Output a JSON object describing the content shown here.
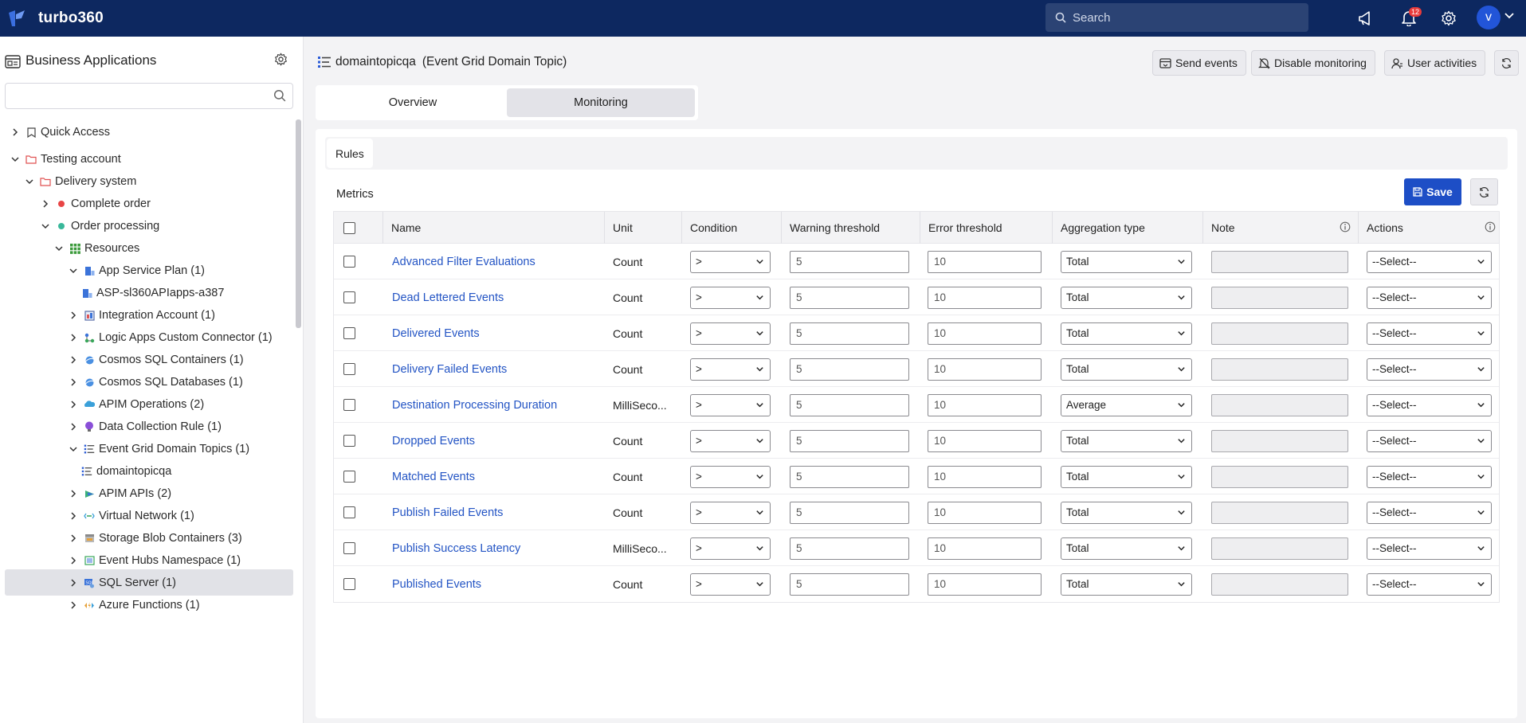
{
  "app": {
    "name": "turbo360",
    "search_placeholder": "Search",
    "notification_count": "12",
    "user_initial": "v"
  },
  "sidebar": {
    "title": "Business Applications",
    "tree": [
      {
        "label": "Quick Access",
        "expanded": false,
        "icon": "bookmark-icon"
      },
      {
        "label": "Testing account",
        "expanded": true,
        "icon": "folder-icon"
      },
      {
        "label": "Delivery system",
        "expanded": true,
        "icon": "folder-icon"
      },
      {
        "label": "Complete order",
        "expanded": false,
        "icon": "status-dot-red"
      },
      {
        "label": "Order processing",
        "expanded": true,
        "icon": "status-dot-green"
      },
      {
        "label": "Resources",
        "expanded": true,
        "icon": "grid-icon"
      },
      {
        "label": "App Service Plan (1)",
        "expanded": true,
        "icon": "app-service-icon"
      },
      {
        "label": "ASP-sl360APIapps-a387",
        "icon": "app-service-icon"
      },
      {
        "label": "Integration Account (1)",
        "expanded": false,
        "icon": "integration-icon"
      },
      {
        "label": "Logic Apps Custom Connector (1)",
        "expanded": false,
        "icon": "connector-icon"
      },
      {
        "label": "Cosmos SQL Containers (1)",
        "expanded": false,
        "icon": "cosmos-icon"
      },
      {
        "label": "Cosmos SQL Databases (1)",
        "expanded": false,
        "icon": "cosmos-icon"
      },
      {
        "label": "APIM Operations (2)",
        "expanded": false,
        "icon": "apim-icon"
      },
      {
        "label": "Data Collection Rule (1)",
        "expanded": false,
        "icon": "bulb-icon"
      },
      {
        "label": "Event Grid Domain Topics (1)",
        "expanded": true,
        "icon": "eventgrid-icon"
      },
      {
        "label": "domaintopicqa",
        "icon": "eventgrid-icon",
        "selected": true
      },
      {
        "label": "APIM APIs (2)",
        "expanded": false,
        "icon": "apim-api-icon"
      },
      {
        "label": "Virtual Network (1)",
        "expanded": false,
        "icon": "vnet-icon"
      },
      {
        "label": "Storage Blob Containers (3)",
        "expanded": false,
        "icon": "storage-icon"
      },
      {
        "label": "Event Hubs Namespace (1)",
        "expanded": false,
        "icon": "eventhub-icon"
      },
      {
        "label": "SQL Server (1)",
        "expanded": false,
        "icon": "sql-icon"
      },
      {
        "label": "Azure Functions (1)",
        "expanded": false,
        "icon": "function-icon"
      }
    ]
  },
  "header": {
    "resource_name": "domaintopicqa",
    "resource_type": "(Event Grid Domain Topic)",
    "buttons": {
      "send_events": "Send events",
      "disable_monitoring": "Disable monitoring",
      "user_activities": "User activities"
    }
  },
  "tabs": {
    "overview": "Overview",
    "monitoring": "Monitoring",
    "active": "monitoring"
  },
  "subtabs": {
    "rules": "Rules"
  },
  "metrics": {
    "label": "Metrics",
    "save_label": "Save",
    "columns": {
      "name": "Name",
      "unit": "Unit",
      "condition": "Condition",
      "warning": "Warning threshold",
      "error": "Error threshold",
      "aggregation": "Aggregation type",
      "note": "Note",
      "actions": "Actions"
    },
    "rows": [
      {
        "name": "Advanced Filter Evaluations",
        "unit": "Count",
        "condition": ">",
        "warning": "5",
        "error": "10",
        "aggregation": "Total",
        "note": "",
        "action": "--Select--"
      },
      {
        "name": "Dead Lettered Events",
        "unit": "Count",
        "condition": ">",
        "warning": "5",
        "error": "10",
        "aggregation": "Total",
        "note": "",
        "action": "--Select--"
      },
      {
        "name": "Delivered Events",
        "unit": "Count",
        "condition": ">",
        "warning": "5",
        "error": "10",
        "aggregation": "Total",
        "note": "",
        "action": "--Select--"
      },
      {
        "name": "Delivery Failed Events",
        "unit": "Count",
        "condition": ">",
        "warning": "5",
        "error": "10",
        "aggregation": "Total",
        "note": "",
        "action": "--Select--"
      },
      {
        "name": "Destination Processing Duration",
        "unit": "MilliSeco...",
        "condition": ">",
        "warning": "5",
        "error": "10",
        "aggregation": "Average",
        "note": "",
        "action": "--Select--"
      },
      {
        "name": "Dropped Events",
        "unit": "Count",
        "condition": ">",
        "warning": "5",
        "error": "10",
        "aggregation": "Total",
        "note": "",
        "action": "--Select--"
      },
      {
        "name": "Matched Events",
        "unit": "Count",
        "condition": ">",
        "warning": "5",
        "error": "10",
        "aggregation": "Total",
        "note": "",
        "action": "--Select--"
      },
      {
        "name": "Publish Failed Events",
        "unit": "Count",
        "condition": ">",
        "warning": "5",
        "error": "10",
        "aggregation": "Total",
        "note": "",
        "action": "--Select--"
      },
      {
        "name": "Publish Success Latency",
        "unit": "MilliSeco...",
        "condition": ">",
        "warning": "5",
        "error": "10",
        "aggregation": "Total",
        "note": "",
        "action": "--Select--"
      },
      {
        "name": "Published Events",
        "unit": "Count",
        "condition": ">",
        "warning": "5",
        "error": "10",
        "aggregation": "Total",
        "note": "",
        "action": "--Select--"
      }
    ]
  },
  "colors": {
    "topbar": "#0d2860",
    "accent": "#1d4ec6",
    "link": "#2354c4",
    "status_red": "#e84545",
    "status_green": "#39b89a",
    "badge": "#e83b3b"
  }
}
